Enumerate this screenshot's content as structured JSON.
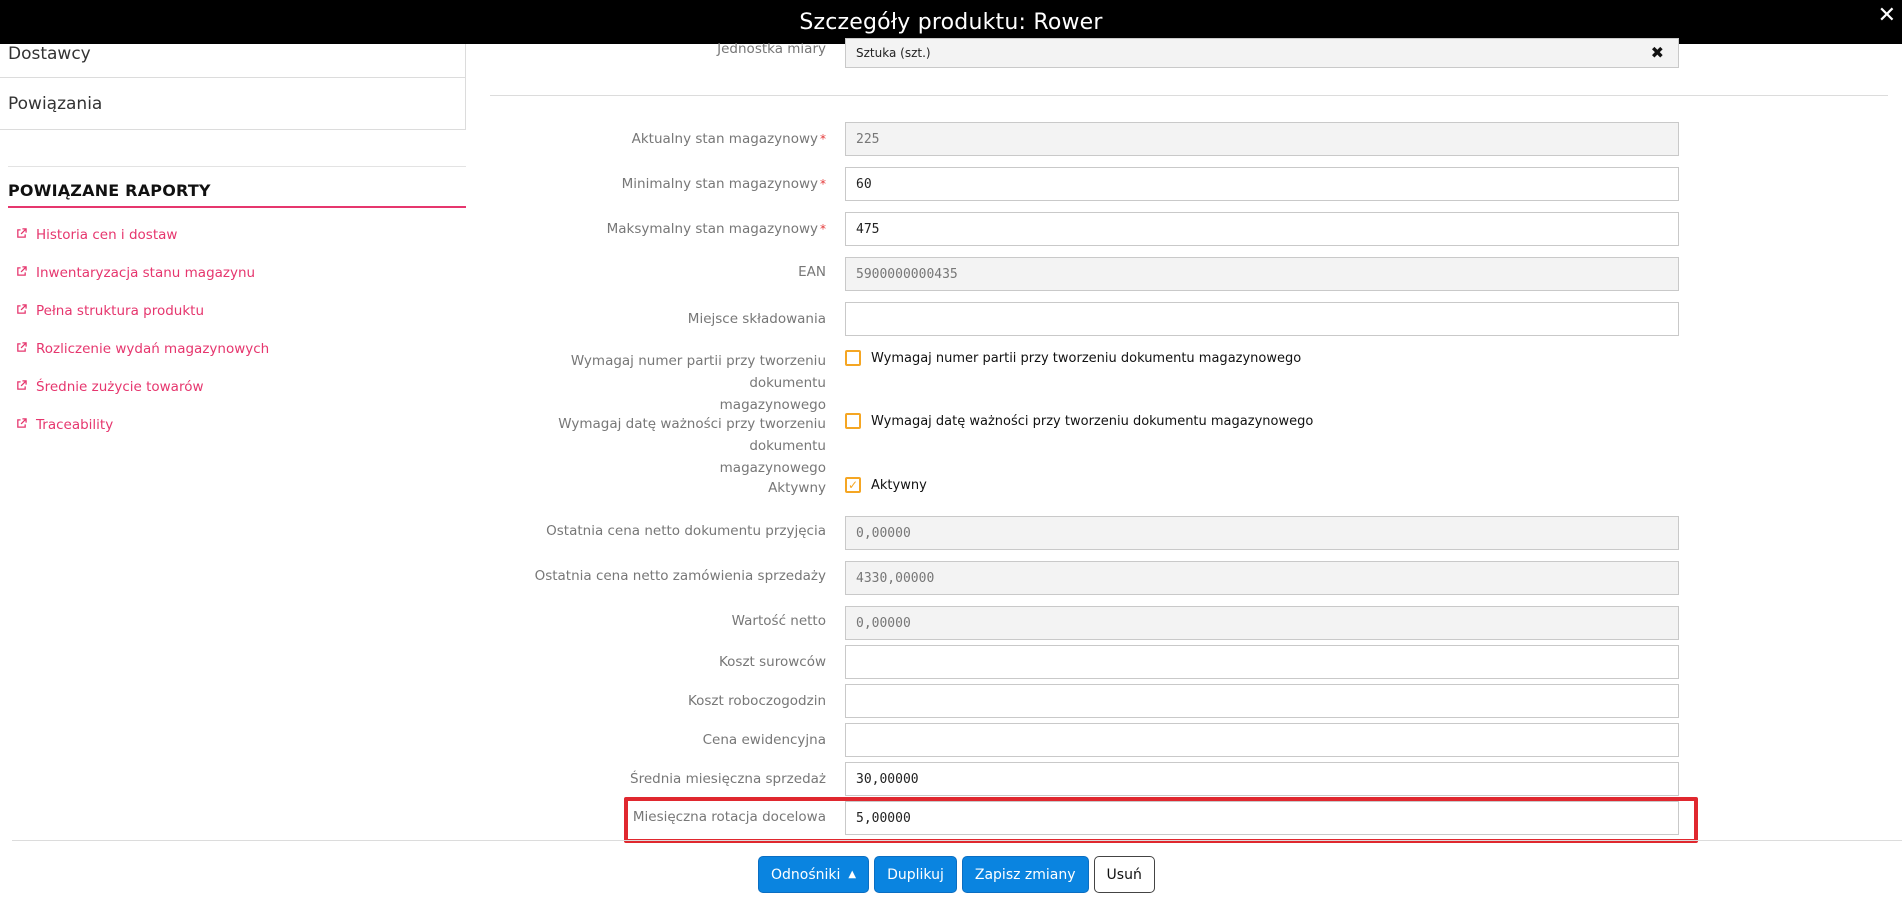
{
  "header": {
    "title": "Szczegóły produktu: Rower",
    "close_glyph": "✕"
  },
  "sidebar": {
    "menu": [
      {
        "label": "Dostawcy"
      },
      {
        "label": "Powiązania"
      }
    ],
    "reports_heading": "POWIĄZANE RAPORTY",
    "reports": [
      {
        "label": "Historia cen i dostaw"
      },
      {
        "label": "Inwentaryzacja stanu magazynu"
      },
      {
        "label": "Pełna struktura produktu"
      },
      {
        "label": "Rozliczenie wydań magazynowych"
      },
      {
        "label": "Średnie zużycie towarów"
      },
      {
        "label": "Traceability"
      }
    ],
    "report_icon": "external-link-icon"
  },
  "form": {
    "unit": {
      "label": "Jednostka miary",
      "value": "Sztuka (szt.)"
    },
    "current_stock": {
      "label": "Aktualny stan magazynowy",
      "value": "225"
    },
    "min_stock": {
      "label": "Minimalny stan magazynowy",
      "value": "60"
    },
    "max_stock": {
      "label": "Maksymalny stan magazynowy",
      "value": "475"
    },
    "ean": {
      "label": "EAN",
      "value": "5900000000435"
    },
    "storage_place": {
      "label": "Miejsce składowania",
      "value": ""
    },
    "require_batch": {
      "label_line1": "Wymagaj numer partii przy tworzeniu dokumentu",
      "label_line2": "magazynowego",
      "checkbox_label": "Wymagaj numer partii przy tworzeniu dokumentu magazynowego",
      "checked": false
    },
    "require_expiry": {
      "label_line1": "Wymagaj datę ważności przy tworzeniu dokumentu",
      "label_line2": "magazynowego",
      "checkbox_label": "Wymagaj datę ważności przy tworzeniu dokumentu magazynowego",
      "checked": false
    },
    "active": {
      "label": "Aktywny",
      "checkbox_label": "Aktywny",
      "checked": true,
      "check_glyph": "✓"
    },
    "last_receipt_price": {
      "label": "Ostatnia cena netto dokumentu przyjęcia",
      "value": "0,00000"
    },
    "last_sales_order_price": {
      "label": "Ostatnia cena netto zamówienia sprzedaży",
      "value": "4330,00000"
    },
    "net_value": {
      "label": "Wartość netto",
      "value": "0,00000"
    },
    "raw_material_cost": {
      "label": "Koszt surowców",
      "value": ""
    },
    "labor_cost": {
      "label": "Koszt roboczogodzin",
      "value": ""
    },
    "standard_price": {
      "label": "Cena ewidencyjna",
      "value": ""
    },
    "avg_monthly_sales": {
      "label": "Średnia miesięczna sprzedaż",
      "value": "30,00000"
    },
    "target_monthly_rotation": {
      "label": "Miesięczna rotacja docelowa",
      "value": "5,00000"
    }
  },
  "actions": {
    "links": "Odnośniki",
    "duplicate": "Duplikuj",
    "save": "Zapisz zmiany",
    "delete": "Usuń"
  },
  "colors": {
    "accent_pink": "#e6366e",
    "primary_blue": "#0a84e0",
    "checkbox_orange": "#f5a623",
    "highlight_red": "#e0282f"
  }
}
